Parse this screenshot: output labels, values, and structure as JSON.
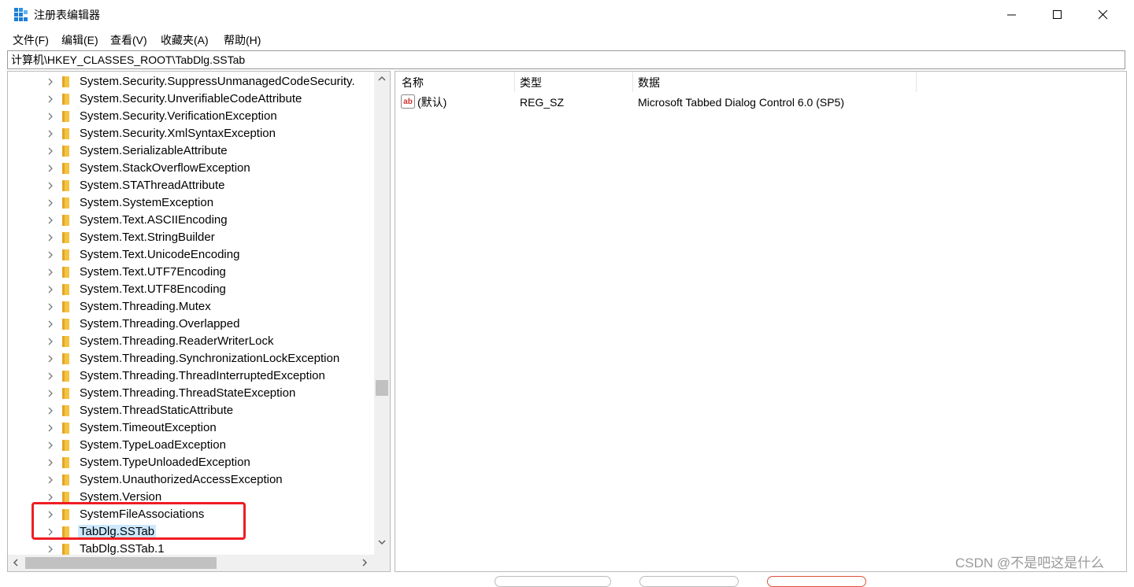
{
  "window": {
    "title": "注册表编辑器",
    "controls": {
      "minimize": "minimize",
      "maximize": "maximize",
      "close": "close"
    }
  },
  "menu": [
    "文件(F)",
    "编辑(E)",
    "查看(V)",
    "收藏夹(A)",
    "帮助(H)"
  ],
  "address": "计算机\\HKEY_CLASSES_ROOT\\TabDlg.SSTab",
  "tree": {
    "items": [
      "System.Security.SuppressUnmanagedCodeSecurity.",
      "System.Security.UnverifiableCodeAttribute",
      "System.Security.VerificationException",
      "System.Security.XmlSyntaxException",
      "System.SerializableAttribute",
      "System.StackOverflowException",
      "System.STAThreadAttribute",
      "System.SystemException",
      "System.Text.ASCIIEncoding",
      "System.Text.StringBuilder",
      "System.Text.UnicodeEncoding",
      "System.Text.UTF7Encoding",
      "System.Text.UTF8Encoding",
      "System.Threading.Mutex",
      "System.Threading.Overlapped",
      "System.Threading.ReaderWriterLock",
      "System.Threading.SynchronizationLockException",
      "System.Threading.ThreadInterruptedException",
      "System.Threading.ThreadStateException",
      "System.ThreadStaticAttribute",
      "System.TimeoutException",
      "System.TypeLoadException",
      "System.TypeUnloadedException",
      "System.UnauthorizedAccessException",
      "System.Version",
      "SystemFileAssociations",
      "TabDlg.SSTab",
      "TabDlg.SSTab.1"
    ],
    "selected": "TabDlg.SSTab"
  },
  "values": {
    "columns": {
      "name": "名称",
      "type": "类型",
      "data": "数据"
    },
    "rows": [
      {
        "name": "(默认)",
        "type": "REG_SZ",
        "data": "Microsoft Tabbed Dialog Control 6.0 (SP5)"
      }
    ]
  },
  "watermark": "CSDN @不是吧这是什么",
  "colors": {
    "selection": "#cce8ff",
    "highlight_box": "#ee1d24",
    "folder": "#f5c342"
  }
}
